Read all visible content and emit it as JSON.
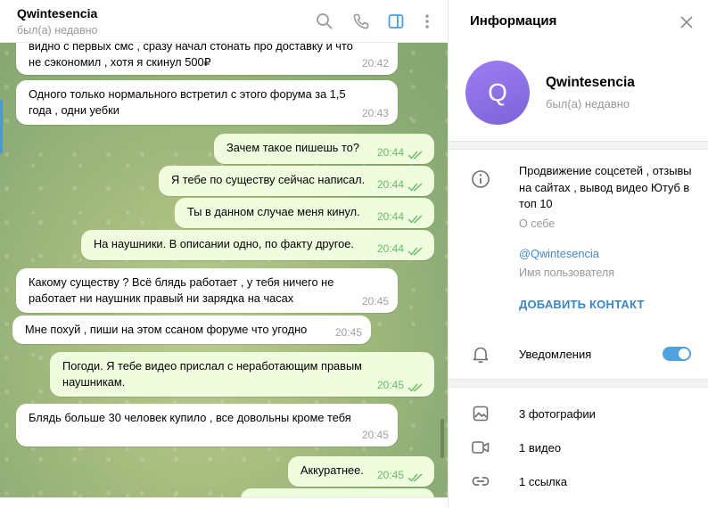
{
  "chat": {
    "title": "Qwintesencia",
    "status": "был(а) недавно",
    "messages": [
      {
        "dir": "in",
        "text": "видно с первых смс , сразу начал стонать про доставку и что не сэкономил , хотя я скинул 500₽",
        "time": "20:42"
      },
      {
        "dir": "in",
        "text": "Одного только нормального встретил с этого форума за 1,5 года , одни уебки",
        "time": "20:43"
      },
      {
        "dir": "out",
        "text": "Зачем такое пишешь то?",
        "time": "20:44"
      },
      {
        "dir": "out",
        "text": "Я тебе по существу сейчас написал.",
        "time": "20:44"
      },
      {
        "dir": "out",
        "text": "Ты в данном случае меня кинул.",
        "time": "20:44"
      },
      {
        "dir": "out",
        "text": "На наушники. В описании одно, по факту другое.",
        "time": "20:44"
      },
      {
        "dir": "in",
        "text": "Какому существу ? Всё блядь работает , у тебя ничего не работает ни наушник правый ни зарядка на часах",
        "time": "20:45"
      },
      {
        "dir": "in",
        "text": "Мне похуй , пиши на этом ссаном форуме что угодно",
        "time": "20:45"
      },
      {
        "dir": "out",
        "text": "Погоди. Я тебе видео прислал с неработающим правым наушникам.",
        "time": "20:45"
      },
      {
        "dir": "in",
        "text": "Блядь больше 30 человек купило , все довольны кроме тебя",
        "time": "20:45"
      },
      {
        "dir": "out",
        "text": "Аккуратнее.",
        "time": "20:45"
      }
    ]
  },
  "info": {
    "title": "Информация",
    "avatar_letter": "Q",
    "name": "Qwintesencia",
    "status": "был(а) недавно",
    "bio": "Продвижение соцсетей , отзывы на сайтах , вывод видео Ютуб в топ 10",
    "bio_label": "О себе",
    "username": "@Qwintesencia",
    "username_label": "Имя пользователя",
    "add_contact": "ДОБАВИТЬ КОНТАКТ",
    "notifications": "Уведомления",
    "notifications_on": true,
    "photos": "3 фотографии",
    "videos": "1 видео",
    "links": "1 ссылка"
  },
  "icons": [
    "search-icon",
    "phone-icon",
    "sidebar-toggle-icon",
    "more-icon",
    "close-icon",
    "info-icon",
    "bell-icon",
    "photo-icon",
    "video-icon",
    "link-icon"
  ],
  "colors": {
    "accent": "#50a2df",
    "link": "#3a85c5",
    "out_bubble": "#effdde",
    "avatar": "#8b6fe4"
  }
}
